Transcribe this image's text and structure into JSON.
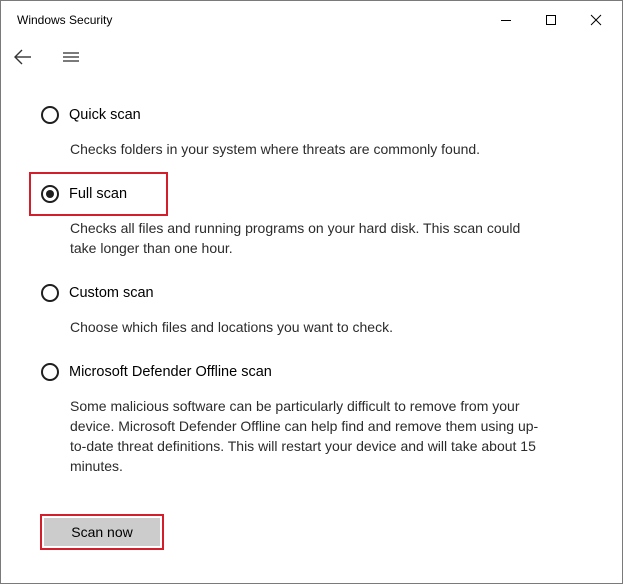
{
  "window": {
    "title": "Windows Security"
  },
  "icons": {
    "minimize": "minimize-icon",
    "maximize": "maximize-icon",
    "close": "close-icon",
    "back": "back-arrow-icon",
    "menu": "hamburger-menu-icon"
  },
  "scan_options": [
    {
      "label": "Quick scan",
      "description": "Checks folders in your system where threats are commonly found.",
      "selected": false
    },
    {
      "label": "Full scan",
      "description": "Checks all files and running programs on your hard disk. This scan could take longer than one hour.",
      "selected": true
    },
    {
      "label": "Custom scan",
      "description": "Choose which files and locations you want to check.",
      "selected": false
    },
    {
      "label": "Microsoft Defender Offline scan",
      "description": "Some malicious software can be particularly difficult to remove from your device. Microsoft Defender Offline can help find and remove them using up-to-date threat definitions. This will restart your device and will take about 15 minutes.",
      "selected": false
    }
  ],
  "actions": {
    "scan_now_label": "Scan now"
  },
  "colors": {
    "highlight": "#d21f2b",
    "button_bg": "#cccccc",
    "radio": "#1f1f1f"
  }
}
